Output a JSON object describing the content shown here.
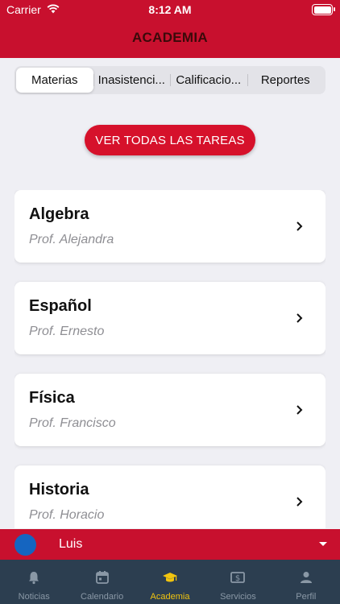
{
  "status_bar": {
    "carrier": "Carrier",
    "time": "8:12 AM"
  },
  "header": {
    "title": "ACADEMIA"
  },
  "segments": {
    "items": [
      "Materias",
      "Inasistenci...",
      "Calificacio...",
      "Reportes"
    ],
    "selected": "Materias"
  },
  "all_tasks_button": {
    "label": "VER TODAS LAS TAREAS"
  },
  "subjects": [
    {
      "name": "Algebra",
      "teacher": "Prof. Alejandra"
    },
    {
      "name": "Español",
      "teacher": "Prof. Ernesto"
    },
    {
      "name": "Física",
      "teacher": "Prof. Francisco"
    },
    {
      "name": "Historia",
      "teacher": "Prof. Horacio"
    }
  ],
  "user_bar": {
    "name": "Luis"
  },
  "tabbar": {
    "items": [
      {
        "label": "Noticias",
        "icon": "bell-icon"
      },
      {
        "label": "Calendario",
        "icon": "calendar-icon"
      },
      {
        "label": "Academia",
        "icon": "graduation-cap-icon"
      },
      {
        "label": "Servicios",
        "icon": "dollar-bill-icon"
      },
      {
        "label": "Perfil",
        "icon": "person-icon"
      }
    ],
    "active": "Academia"
  },
  "colors": {
    "brand_red": "#c8102e",
    "button_red": "#d6112b",
    "tabbar_bg": "#2c3e50",
    "tab_active": "#f1c40f",
    "tab_inactive": "#8a98a6",
    "avatar": "#1565c0"
  }
}
